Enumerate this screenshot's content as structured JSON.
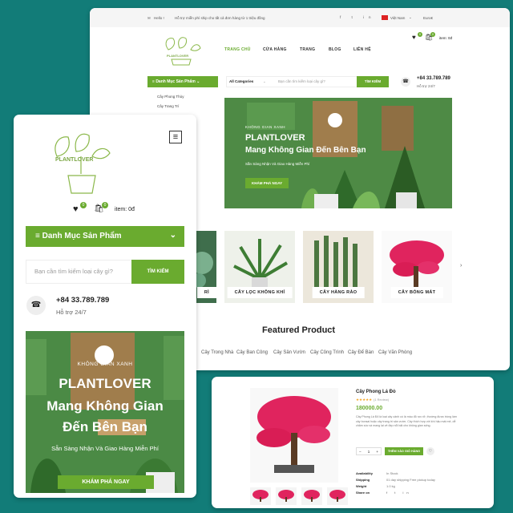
{
  "desktop": {
    "topbar": {
      "greeting": "Hello !",
      "promo": "Hỗ trợ miễn phí ship cho tất cả đơn hàng từ 1 triệu đồng",
      "language": "Việt Nam",
      "currency": "Euro€"
    },
    "logo_text": "PLANTLOVER",
    "nav": [
      "TRANG CHỦ",
      "CỬA HÀNG",
      "TRANG",
      "BLOG",
      "LIÊN HỆ"
    ],
    "cart_label": "item: 0đ",
    "wishlist_count": "0",
    "cart_count": "0",
    "category_button": "Danh Mục Sản Phẩm",
    "category_menu": [
      "Cây Phong Thủy",
      "Cây Trang Trí"
    ],
    "category_select": "All Categories",
    "search_placeholder": "Bạn cần tìm kiếm loại cây gì?",
    "search_button": "TÌM KIẾM",
    "phone": "+84 33.789.789",
    "support": "Hỗ trợ 24/7",
    "hero": {
      "kicker": "KHÔNG GIAN XANH",
      "title": "PLANTLOVER",
      "subtitle": "Mang Không Gian Đến Bên Bạn",
      "tagline": "Sẵn Sàng Nhận Và Giao Hàng Miễn Phí",
      "button": "KHÁM PHÁ NGAY"
    },
    "categories": [
      "RÌ",
      "CÂY LỌC KHÔNG KHÍ",
      "CÂY HÀNG RÀO",
      "CÂY BÓNG MÁT"
    ],
    "featured_title": "Featured Product",
    "tabs": [
      "Cây Trong Nhà",
      "Cây Ban Công",
      "Cây Sân Vườn",
      "Cây Công Trình",
      "Cây Để Bàn",
      "Cây Văn Phòng"
    ],
    "colors": {
      "accent": "#6aab2f",
      "text": "#222222"
    }
  },
  "mobile": {
    "logo_text": "PLANTLOVER",
    "wishlist_count": "0",
    "cart_count": "0",
    "cart_label": "item: 0đ",
    "category_button": "Danh Mục Sản Phẩm",
    "search_placeholder": "Bạn cần tìm kiếm loại cây gì?",
    "search_button": "TÌM KIẾM",
    "phone": "+84 33.789.789",
    "support": "Hỗ trợ 24/7",
    "hero": {
      "kicker": "KHÔNG GIAN XANH",
      "title": "PLANTLOVER",
      "subtitle_line1": "Mang Không Gian",
      "subtitle_line2": "Đến Bên Bạn",
      "tagline": "Sẵn Sàng Nhận Và Giao Hàng Miễn Phí",
      "button": "KHÁM PHÁ NGAY"
    }
  },
  "product": {
    "name": "Cây Phong Lá Đỏ",
    "reviews": "(1 Review)",
    "rating": 5,
    "price": "180000.00",
    "description": "Cây Phong Lá Đỏ là loại cây cảnh có lá màu đỏ rực rỡ, thường được trồng làm cây bonsai hoặc cây trang trí sân vườn. Cây thích hợp với khí hậu mát mẻ, dễ chăm sóc và mang lại vẻ đẹp nổi bật cho không gian sống.",
    "add_to_cart": "THÊM VÀO GIỎ HÀNG",
    "quantity": "1",
    "meta": [
      {
        "k": "Availability",
        "v": "In Stock"
      },
      {
        "k": "Shipping",
        "v": "01 day shipping Free pickup today"
      },
      {
        "k": "Weight",
        "v": "1.0 kg"
      },
      {
        "k": "Share on",
        "v": ""
      }
    ]
  }
}
